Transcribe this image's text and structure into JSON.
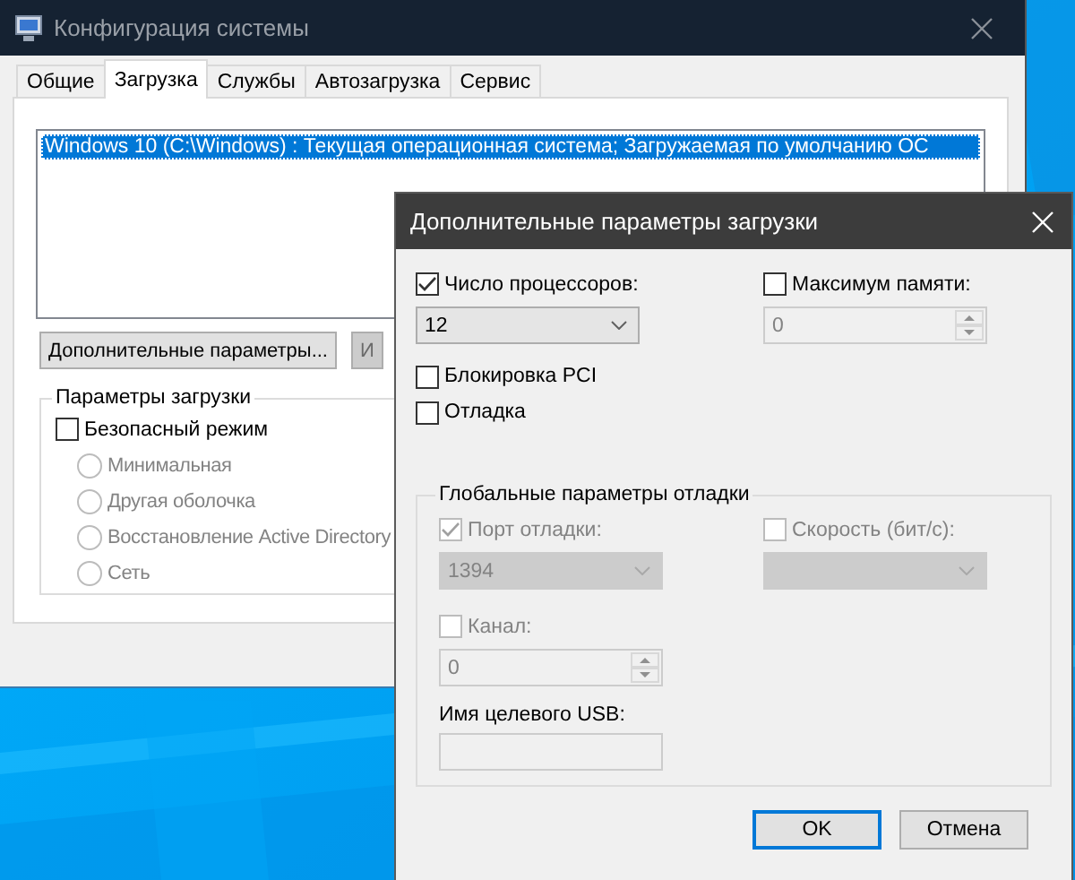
{
  "window": {
    "title": "Конфигурация системы"
  },
  "tabs": [
    {
      "label": "Общие",
      "selected": false
    },
    {
      "label": "Загрузка",
      "selected": true
    },
    {
      "label": "Службы",
      "selected": false
    },
    {
      "label": "Автозагрузка",
      "selected": false
    },
    {
      "label": "Сервис",
      "selected": false
    }
  ],
  "boot_list": [
    {
      "text": "Windows 10 (C:\\Windows) : Текущая операционная система; Загружаемая по умолчанию ОС",
      "selected": true
    }
  ],
  "buttons": [
    {
      "label": "Дополнительные параметры...",
      "disabled": false
    },
    {
      "label": "И",
      "disabled": true
    }
  ],
  "boot_options": {
    "title": "Параметры загрузки",
    "safe_mode": {
      "label": "Безопасный режим",
      "checked": false
    },
    "options": [
      {
        "label": "Минимальная",
        "selected": false
      },
      {
        "label": "Другая оболочка",
        "selected": false
      },
      {
        "label": "Восстановление Active Directory",
        "selected": false
      },
      {
        "label": "Сеть",
        "selected": false
      }
    ]
  },
  "dialog": {
    "title": "Дополнительные параметры загрузки",
    "processors": {
      "label": "Число процессоров:",
      "checked": true,
      "value": "12"
    },
    "max_memory": {
      "label": "Максимум памяти:",
      "checked": false,
      "value": "0"
    },
    "pci_lock": {
      "label": "Блокировка PCI",
      "checked": false
    },
    "debug": {
      "label": "Отладка",
      "checked": false
    },
    "debug_group": {
      "title": "Глобальные параметры отладки",
      "port": {
        "label": "Порт отладки:",
        "checked": true,
        "value": "1394"
      },
      "baud": {
        "label": "Скорость (бит/с):",
        "checked": false
      },
      "channel": {
        "label": "Канал:",
        "checked": false,
        "value": "0"
      },
      "usb_label": "Имя целевого USB:"
    },
    "buttons": [
      {
        "label": "OK",
        "focused": true
      },
      {
        "label": "Отмена",
        "focused": false
      }
    ]
  }
}
